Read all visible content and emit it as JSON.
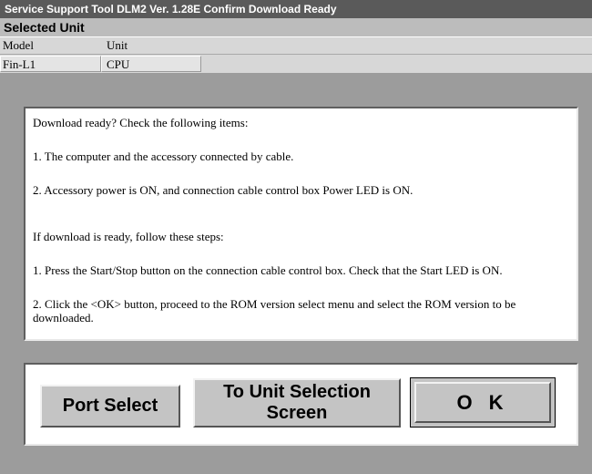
{
  "window": {
    "title": "Service Support Tool DLM2 Ver. 1.28E  Confirm Download Ready"
  },
  "selected_unit": {
    "header": "Selected Unit",
    "columns": [
      "Model",
      "Unit"
    ],
    "values": [
      "Fin-L1",
      "CPU"
    ]
  },
  "info": {
    "lines": [
      "Download ready? Check the following items:",
      "1. The computer and the accessory connected by cable.",
      "2. Accessory power is ON, and connection cable control box Power LED is ON.",
      "If download is ready, follow these steps:",
      "1. Press the Start/Stop button on the connection cable control box. Check that the Start LED is ON.",
      "2. Click the <OK> button, proceed to the ROM version select menu and select the ROM version to be downloaded."
    ]
  },
  "buttons": {
    "port_select": "Port Select",
    "unit_selection_line1": "To Unit Selection",
    "unit_selection_line2": "Screen",
    "ok": "O K"
  },
  "colors": {
    "title_bar": "#5a5a5a",
    "panel_bg": "#9c9c9c",
    "button_face": "#c4c4c4"
  }
}
